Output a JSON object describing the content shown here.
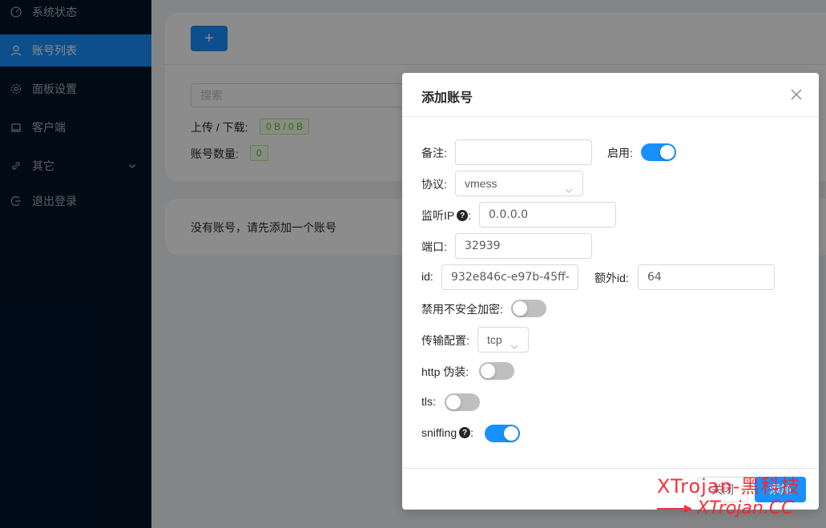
{
  "sidebar": {
    "items": [
      {
        "label": "系统状态",
        "icon": "dashboard-icon",
        "active": false
      },
      {
        "label": "账号列表",
        "icon": "user-icon",
        "active": true
      },
      {
        "label": "面板设置",
        "icon": "gear-icon",
        "active": false
      },
      {
        "label": "客户端",
        "icon": "laptop-icon",
        "active": false
      },
      {
        "label": "其它",
        "icon": "link-icon",
        "active": false,
        "has_submenu": true
      },
      {
        "label": "退出登录",
        "icon": "logout-icon",
        "active": false
      }
    ]
  },
  "main": {
    "add_button_label": "+",
    "search_placeholder": "搜索",
    "traffic_label": "上传 / 下载:",
    "traffic_value": "0 B / 0 B",
    "count_label": "账号数量:",
    "count_value": "0",
    "empty_text": "没有账号，请先添加一个账号"
  },
  "modal": {
    "title": "添加账号",
    "fields": {
      "remark_label": "备注:",
      "remark_value": "",
      "enable_label": "启用:",
      "enable_on": true,
      "protocol_label": "协议:",
      "protocol_value": "vmess",
      "listen_label": "监听IP",
      "listen_colon": ":",
      "listen_value": "0.0.0.0",
      "port_label": "端口:",
      "port_value": "32939",
      "id_label": "id:",
      "id_value": "932e846c-e97b-45ff-",
      "alter_label": "额外id:",
      "alter_value": "64",
      "insecure_label": "禁用不安全加密:",
      "insecure_on": false,
      "transport_label": "传输配置:",
      "transport_value": "tcp",
      "http_label": "http 伪装:",
      "http_on": false,
      "tls_label": "tls:",
      "tls_on": false,
      "sniffing_label": "sniffing",
      "sniffing_colon": ":",
      "sniffing_on": true
    },
    "footer": {
      "close_label": "关闭",
      "add_label": "添加"
    }
  },
  "watermark": {
    "line1": "XTrojan-黑科技",
    "line2": "XTrojan.CC"
  },
  "colors": {
    "primary": "#1890ff",
    "sidebar_bg": "#001529",
    "tag_green": "#52c41a",
    "watermark_red": "#f5222d"
  }
}
